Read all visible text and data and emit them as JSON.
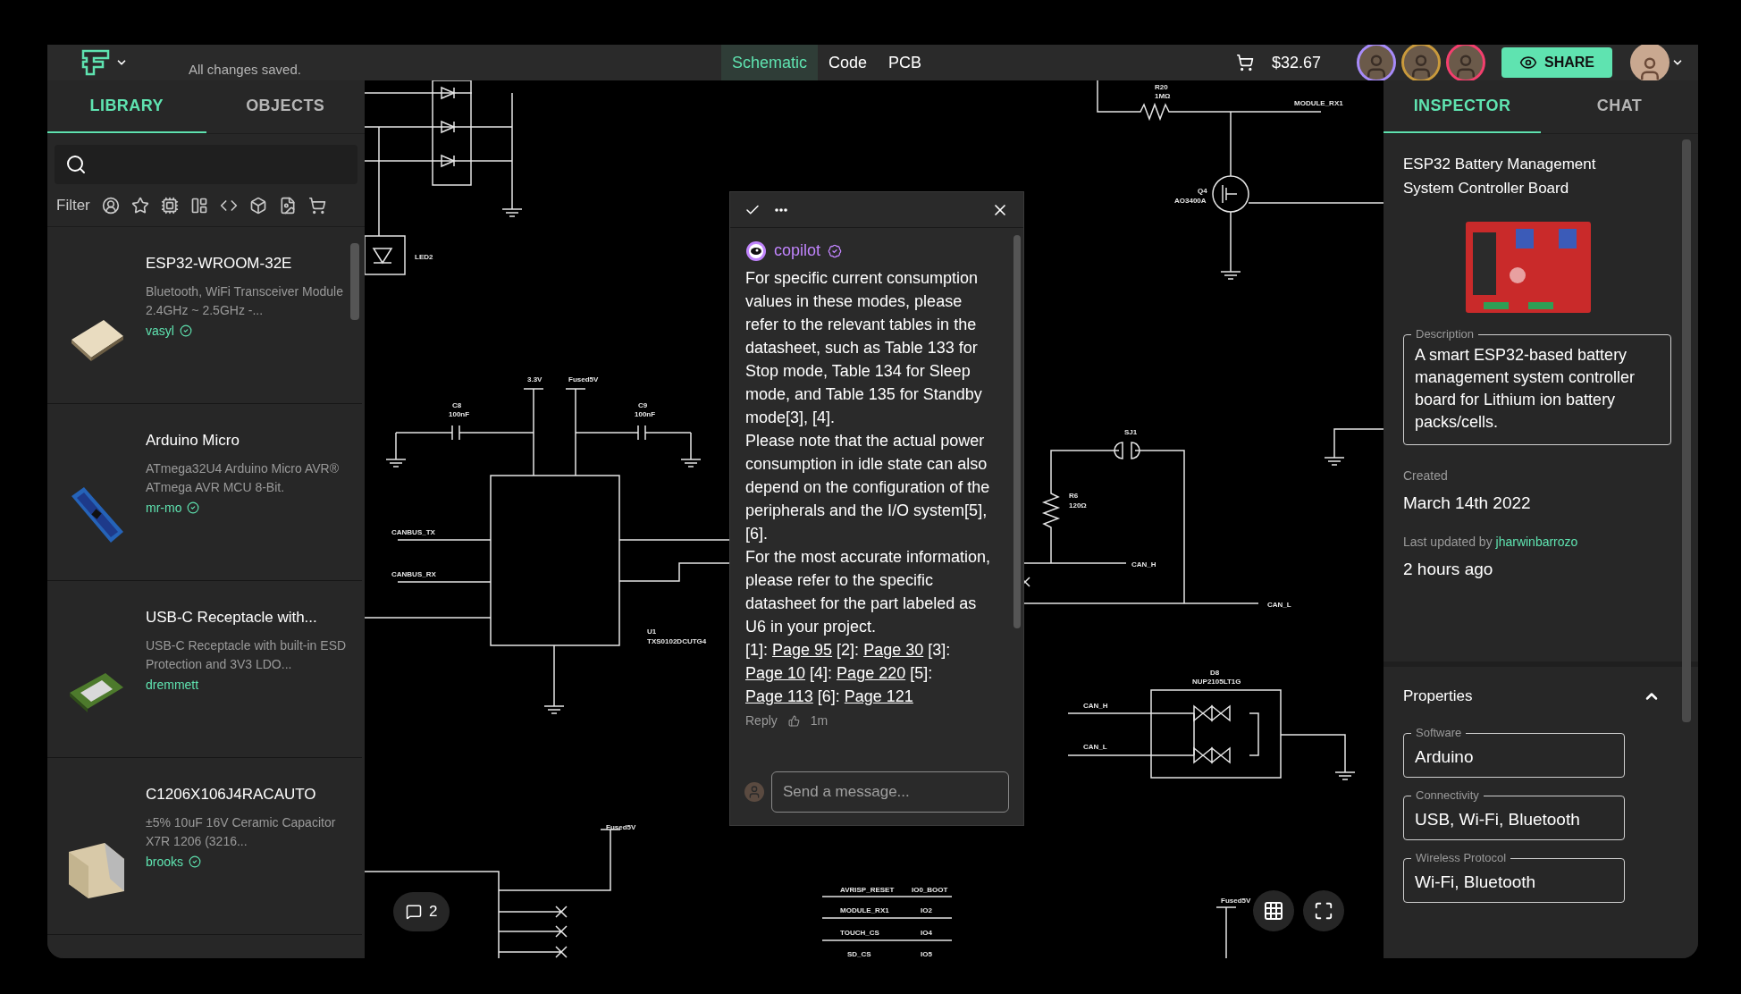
{
  "header": {
    "status": "All changes saved.",
    "view_tabs": [
      {
        "label": "Schematic",
        "selected": true
      },
      {
        "label": "Code",
        "selected": false
      },
      {
        "label": "PCB",
        "selected": false
      }
    ],
    "price": "$32.67",
    "collaborators": [
      {
        "color": "#a78bfa"
      },
      {
        "color": "#c99a3c"
      },
      {
        "color": "#f43f6e"
      }
    ],
    "share_label": "SHARE"
  },
  "library": {
    "tabs": [
      {
        "label": "LIBRARY",
        "selected": true
      },
      {
        "label": "OBJECTS",
        "selected": false
      }
    ],
    "filter_label": "Filter",
    "items": [
      {
        "kind": "module",
        "title": "ESP32-WROOM-32E",
        "description": "Bluetooth, WiFi Transceiver Module 2.4GHz ~ 2.5GHz -...",
        "author": "vasyl",
        "verified": true
      },
      {
        "kind": "board",
        "title": "Arduino Micro",
        "description": "ATmega32U4 Arduino Micro AVR® ATmega AVR MCU 8-Bit.",
        "author": "mr-mo",
        "verified": true
      },
      {
        "kind": "pcb",
        "title": "USB-C Receptacle with...",
        "description": "USB-C Receptacle with built-in ESD Protection and 3V3 LDO...",
        "author": "dremmett",
        "verified": false
      },
      {
        "kind": "capacitor",
        "title": "C1206X106J4RACAUTO",
        "description": "±5% 10uF 16V Ceramic Capacitor X7R 1206 (3216...",
        "author": "brooks",
        "verified": true
      }
    ]
  },
  "schematic": {
    "labels": [
      "LED2",
      "3.3V",
      "Fused5V",
      "C8",
      "100nF",
      "C9",
      "100nF",
      "CANBUS_TX",
      "CANBUS_RX",
      "U1",
      "TXS0102DCUTG4",
      "R20",
      "1MΩ",
      "MODULE_RX1",
      "Q4",
      "AO3400A",
      "SJ1",
      "R6",
      "120Ω",
      "CAN_H",
      "CAN_L",
      "D8",
      "NUP2105LT1G",
      "CAN_H",
      "CAN_L",
      "Fused5V",
      "AVRISP_RESET",
      "IO0_BOOT",
      "MODULE_RX1",
      "IO2",
      "TOUCH_CS",
      "IO4",
      "SD_CS",
      "IO5",
      "Fused5V"
    ]
  },
  "canvas_controls": {
    "comment_count": "2"
  },
  "comment_thread": {
    "author": "copilot",
    "verified": true,
    "paragraphs": [
      "For specific current consumption values in these modes, please refer to the relevant tables in the datasheet, such as Table 133 for Stop mode, Table 134 for Sleep mode, and Table 135 for Standby mode[3], [4].",
      "Please note that the actual power consumption in idle state can also depend on the configuration of the peripherals and the I/O system[5], [6].",
      "For the most accurate information, please refer to the specific datasheet for the part labeled as U6 in your project."
    ],
    "references": [
      {
        "index": "[1]:",
        "link": "Page 95"
      },
      {
        "index": "[2]:",
        "link": "Page 30"
      },
      {
        "index": "[3]:",
        "link": "Page 10"
      },
      {
        "index": "[4]:",
        "link": "Page 220"
      },
      {
        "index": "[5]:",
        "link": "Page 113"
      },
      {
        "index": "[6]:",
        "link": "Page 121"
      }
    ],
    "reply_label": "Reply",
    "time": "1m",
    "placeholder": "Send a message..."
  },
  "inspector": {
    "tabs": [
      {
        "label": "INSPECTOR",
        "selected": true
      },
      {
        "label": "CHAT",
        "selected": false
      }
    ],
    "title": "ESP32 Battery Management System Controller Board",
    "description_label": "Description",
    "description": "A smart ESP32-based battery management system controller board for Lithium ion battery packs/cells.",
    "created_label": "Created",
    "created": "March 14th 2022",
    "updated_label": "Last updated by",
    "updated_by": "jharwinbarrozo",
    "updated": "2 hours ago",
    "properties_label": "Properties",
    "properties_expanded": true,
    "properties": [
      {
        "label": "Software",
        "value": "Arduino"
      },
      {
        "label": "Connectivity",
        "value": "USB, Wi-Fi, Bluetooth"
      },
      {
        "label": "Wireless Protocol",
        "value": "Wi-Fi, Bluetooth"
      }
    ]
  }
}
